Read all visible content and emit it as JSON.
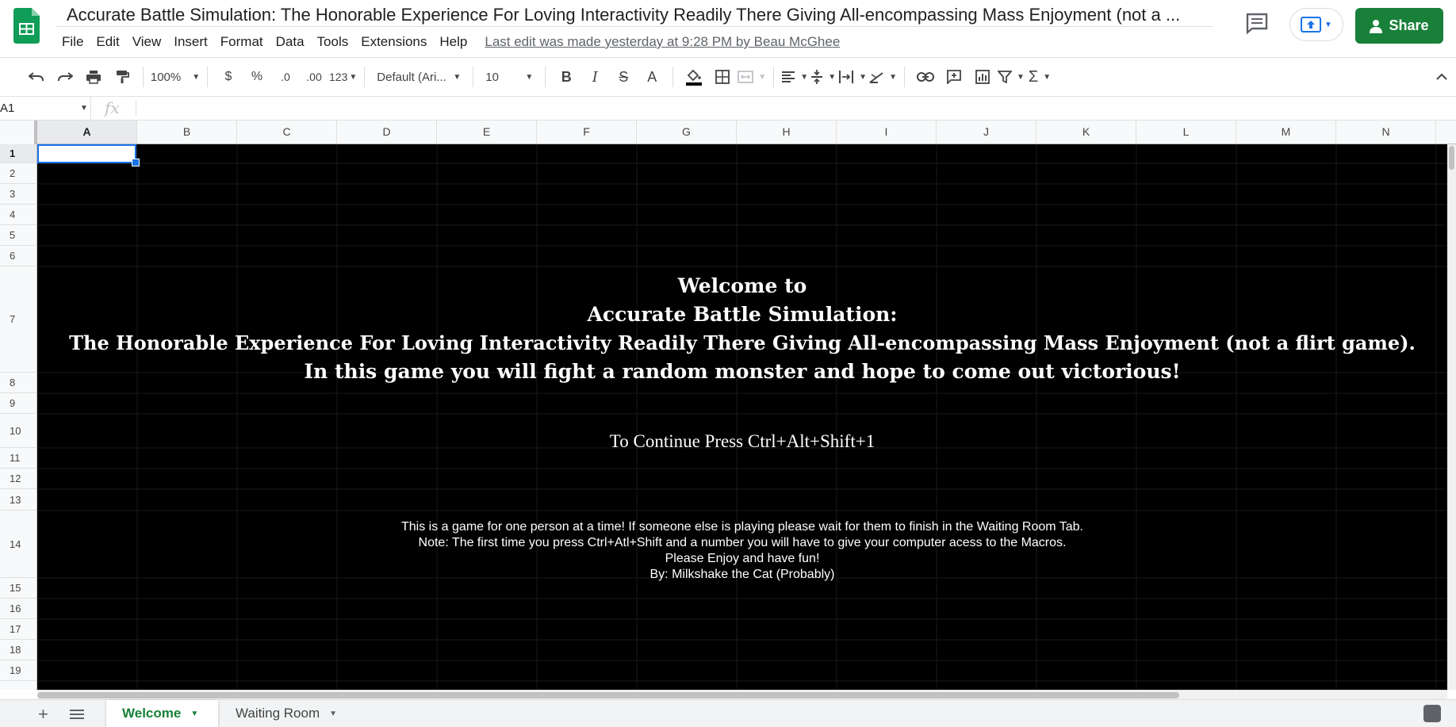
{
  "doc": {
    "title": "Accurate Battle Simulation: The Honorable Experience For Loving Interactivity Readily There Giving All-encompassing Mass Enjoyment (not a ...",
    "last_edit": "Last edit was made yesterday at 9:28 PM by Beau McGhee",
    "share_label": "Share"
  },
  "menu": [
    "File",
    "Edit",
    "View",
    "Insert",
    "Format",
    "Data",
    "Tools",
    "Extensions",
    "Help"
  ],
  "toolbar": {
    "zoom": "100%",
    "currency": "$",
    "percent": "%",
    "dec_decrease": ".0",
    "dec_increase": ".00",
    "more_formats": "123",
    "font": "Default (Ari...",
    "font_size": "10",
    "bold": "B",
    "italic": "I",
    "strike": "S",
    "text_color": "A",
    "function": "Σ"
  },
  "formula_bar": {
    "name_box": "A1",
    "fx": "fx",
    "value": ""
  },
  "columns": [
    "A",
    "B",
    "C",
    "D",
    "E",
    "F",
    "G",
    "H",
    "I",
    "J",
    "K",
    "L",
    "M",
    "N"
  ],
  "rows": [
    "1",
    "2",
    "3",
    "4",
    "5",
    "6",
    "7",
    "8",
    "9",
    "10",
    "11",
    "12",
    "13",
    "14",
    "15",
    "16",
    "17",
    "18",
    "19"
  ],
  "content": {
    "welcome_lines": [
      "Welcome to",
      "Accurate Battle Simulation:",
      "The Honorable Experience For Loving Interactivity Readily There Giving All-encompassing Mass Enjoyment (not a flirt game).",
      "In this game you will fight a random monster and hope to come out victorious!"
    ],
    "continue": "To Continue Press Ctrl+Alt+Shift+1",
    "notes": [
      "This is a game for one person at a time! If someone else is playing please wait for them to finish in the Waiting Room Tab.",
      "Note: The first time you press Ctrl+Atl+Shift and a number you will have to give your computer acess to the Macros.",
      "Please Enjoy and have fun!",
      "By: Milkshake the Cat (Probably)"
    ]
  },
  "sheets": [
    {
      "name": "Welcome",
      "active": true
    },
    {
      "name": "Waiting Room",
      "active": false
    }
  ],
  "colors": {
    "accent": "#188038",
    "selection": "#1a73e8",
    "sheet_bg": "#000000"
  }
}
